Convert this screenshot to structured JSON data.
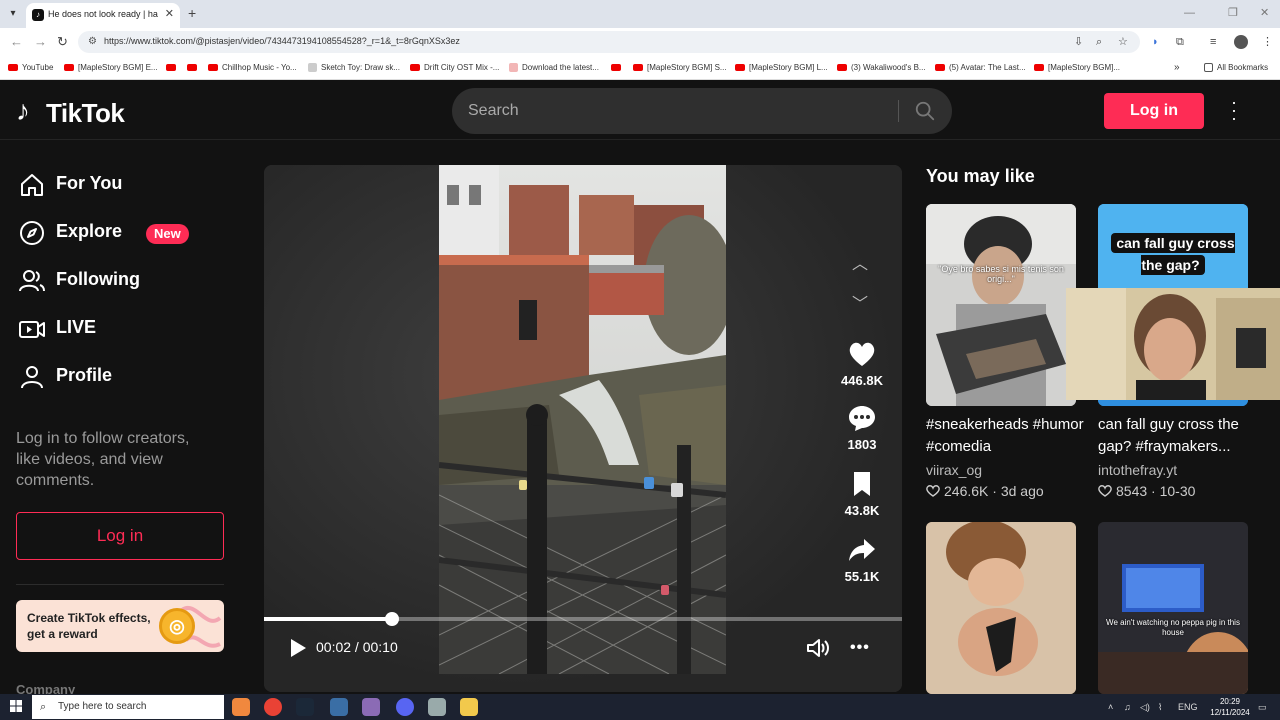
{
  "browser": {
    "tab_title": "He does not look ready | happy",
    "new_tab_glyph": "+",
    "url": "https://www.tiktok.com/@pistasjen/video/7434473194108554528?_r=1&_t=8rGqnXSx3ez",
    "bookmarks": [
      {
        "label": "YouTube",
        "icon": "youtube"
      },
      {
        "label": "[MapleStory BGM] E...",
        "icon": "youtube"
      },
      {
        "label": "",
        "icon": "youtube"
      },
      {
        "label": "",
        "icon": "youtube"
      },
      {
        "label": "Chillhop Music - Yo...",
        "icon": "youtube"
      },
      {
        "label": "Sketch Toy: Draw sk...",
        "icon": "sketch"
      },
      {
        "label": "Drift City OST Mix -...",
        "icon": "youtube"
      },
      {
        "label": "Download the latest...",
        "icon": "download"
      },
      {
        "label": "",
        "icon": "youtube"
      },
      {
        "label": "[MapleStory BGM] S...",
        "icon": "youtube"
      },
      {
        "label": "[MapleStory BGM] L...",
        "icon": "youtube"
      },
      {
        "label": "(3) Wakaliwood's B...",
        "icon": "youtube"
      },
      {
        "label": "(5) Avatar: The Last...",
        "icon": "youtube"
      },
      {
        "label": "[MapleStory BGM]...",
        "icon": "youtube"
      }
    ],
    "bookmarks_overflow": "»",
    "all_bookmarks": "All Bookmarks"
  },
  "header": {
    "logo_text": "TikTok",
    "search_placeholder": "Search",
    "login_label": "Log in"
  },
  "sidebar": {
    "items": [
      {
        "label": "For You",
        "icon": "home-icon"
      },
      {
        "label": "Explore",
        "icon": "compass-icon",
        "badge": "New"
      },
      {
        "label": "Following",
        "icon": "users-icon"
      },
      {
        "label": "LIVE",
        "icon": "live-icon"
      },
      {
        "label": "Profile",
        "icon": "person-icon"
      }
    ],
    "login_prompt": "Log in to follow creators, like videos, and view comments.",
    "login_label": "Log in",
    "effects_banner": "Create TikTok effects, get a reward",
    "company_label": "Company"
  },
  "player": {
    "likes": "446.8K",
    "comments": "1803",
    "bookmarks": "43.8K",
    "shares": "55.1K",
    "time": "00:02 / 00:10",
    "progress": 0.2
  },
  "recommendations": {
    "title": "You may like",
    "cards": [
      {
        "caption": "#sneakerheads #humor #comedia",
        "author": "viirax_og",
        "likes": "246.6K",
        "date": "3d ago",
        "overlay": "\"Oye bro sabes si mis tenis son origi...\""
      },
      {
        "caption": "can fall guy cross the gap? #fraymakers...",
        "author": "intothefray.yt",
        "likes": "8543",
        "date": "10-30",
        "overlay": "can fall guy cross the gap?"
      },
      {
        "overlay": ""
      },
      {
        "overlay": "We ain't watching no peppa pig in this house"
      }
    ]
  },
  "taskbar": {
    "search_placeholder": "Type here to search",
    "lang": "ENG",
    "time": "20:29",
    "date": "12/11/2024"
  },
  "colors": {
    "accent": "#fe2c55",
    "background": "#121212"
  }
}
